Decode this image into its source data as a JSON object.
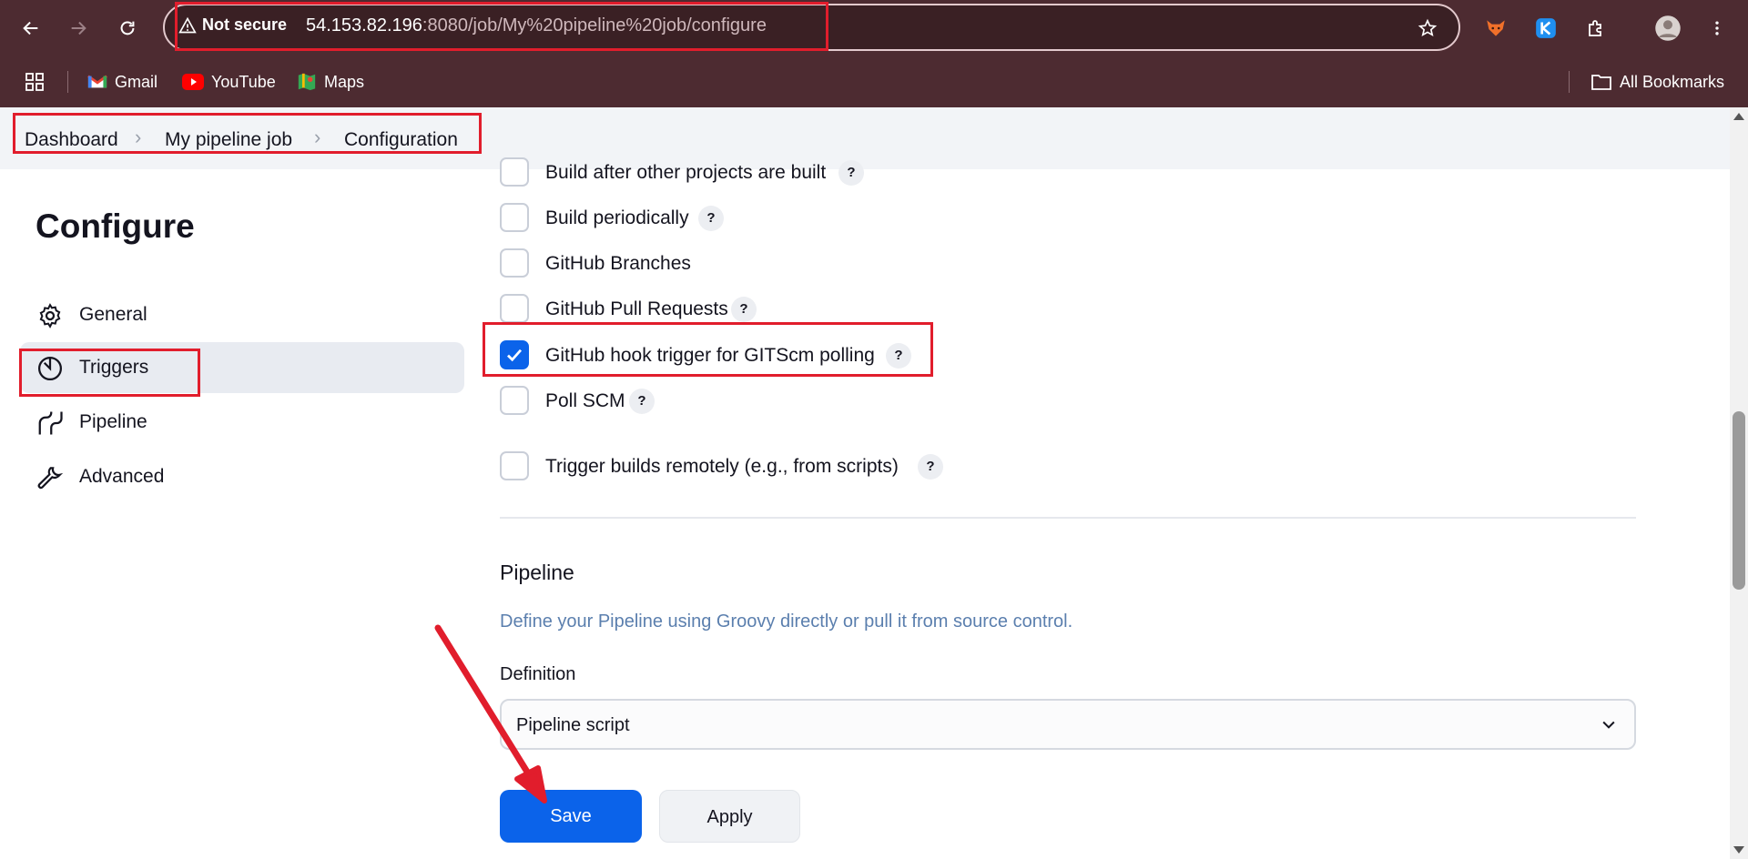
{
  "browser": {
    "security_label": "Not secure",
    "url_host": "54.153.82.196",
    "url_rest": ":8080/job/My%20pipeline%20job/configure",
    "bookmarks": [
      {
        "label": "Gmail",
        "icon": "gmail-icon"
      },
      {
        "label": "YouTube",
        "icon": "youtube-icon"
      },
      {
        "label": "Maps",
        "icon": "maps-icon"
      }
    ],
    "all_bookmarks": "All Bookmarks"
  },
  "breadcrumb": {
    "items": [
      "Dashboard",
      "My pipeline job",
      "Configuration"
    ],
    "separator": "›"
  },
  "page": {
    "title": "Configure"
  },
  "sidebar": {
    "items": [
      {
        "label": "General",
        "icon": "gear-icon"
      },
      {
        "label": "Triggers",
        "icon": "timer-icon",
        "active": true
      },
      {
        "label": "Pipeline",
        "icon": "pipeline-icon"
      },
      {
        "label": "Advanced",
        "icon": "wrench-icon"
      }
    ]
  },
  "triggers": {
    "options": [
      {
        "label": "Build after other projects are built",
        "checked": false,
        "help": "?"
      },
      {
        "label": "Build periodically",
        "checked": false,
        "help": "?"
      },
      {
        "label": "GitHub Branches",
        "checked": false,
        "help": ""
      },
      {
        "label": "GitHub Pull Requests",
        "checked": false,
        "help": "?"
      },
      {
        "label": "GitHub hook trigger for GITScm polling",
        "checked": true,
        "help": "?"
      },
      {
        "label": "Poll SCM",
        "checked": false,
        "help": "?"
      },
      {
        "label": "Trigger builds remotely (e.g., from scripts)",
        "checked": false,
        "help": "?"
      }
    ]
  },
  "pipeline": {
    "title": "Pipeline",
    "description": "Define your Pipeline using Groovy directly or pull it from source control.",
    "definition_label": "Definition",
    "definition_value": "Pipeline script"
  },
  "actions": {
    "save_label": "Save",
    "apply_label": "Apply"
  },
  "colors": {
    "chrome": "#4d2b31",
    "accent": "#0b63ea",
    "annotation": "#e11d2c"
  }
}
